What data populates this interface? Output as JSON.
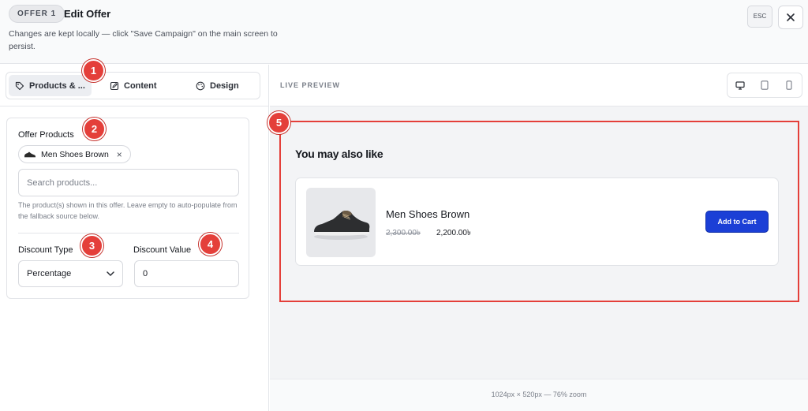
{
  "header": {
    "badge": "OFFER 1",
    "title": "Edit Offer",
    "subtitle": "Changes are kept locally — click \"Save Campaign\" on the main screen to persist.",
    "esc_label": "ESC",
    "close_icon": "close-icon"
  },
  "tabs": [
    {
      "label": "Products & ...",
      "icon": "tag-icon",
      "active": true
    },
    {
      "label": "Content",
      "icon": "edit-icon",
      "active": false
    },
    {
      "label": "Design",
      "icon": "palette-icon",
      "active": false
    }
  ],
  "form": {
    "offer_products_label": "Offer Products",
    "selected_product": "Men Shoes Brown",
    "remove_chip_symbol": "×",
    "search_placeholder": "Search products...",
    "help_text": "The product(s) shown in this offer. Leave empty to auto-populate from the fallback source below.",
    "discount_type_label": "Discount Type",
    "discount_type_value": "Percentage",
    "discount_value_label": "Discount Value",
    "discount_value": "0"
  },
  "markers": [
    "1",
    "2",
    "3",
    "4",
    "5"
  ],
  "preview": {
    "label": "LIVE PREVIEW",
    "devices": [
      "desktop-icon",
      "tablet-icon",
      "mobile-icon"
    ],
    "section_title": "You may also like",
    "product": {
      "name": "Men Shoes Brown",
      "old_price": "2,300.00৳",
      "new_price": "2,200.00৳",
      "cta": "Add to Cart"
    },
    "footer": "1024px × 520px — 76% zoom"
  },
  "colors": {
    "accent_red": "#e43f3a",
    "cta_blue": "#1b3fd6"
  }
}
